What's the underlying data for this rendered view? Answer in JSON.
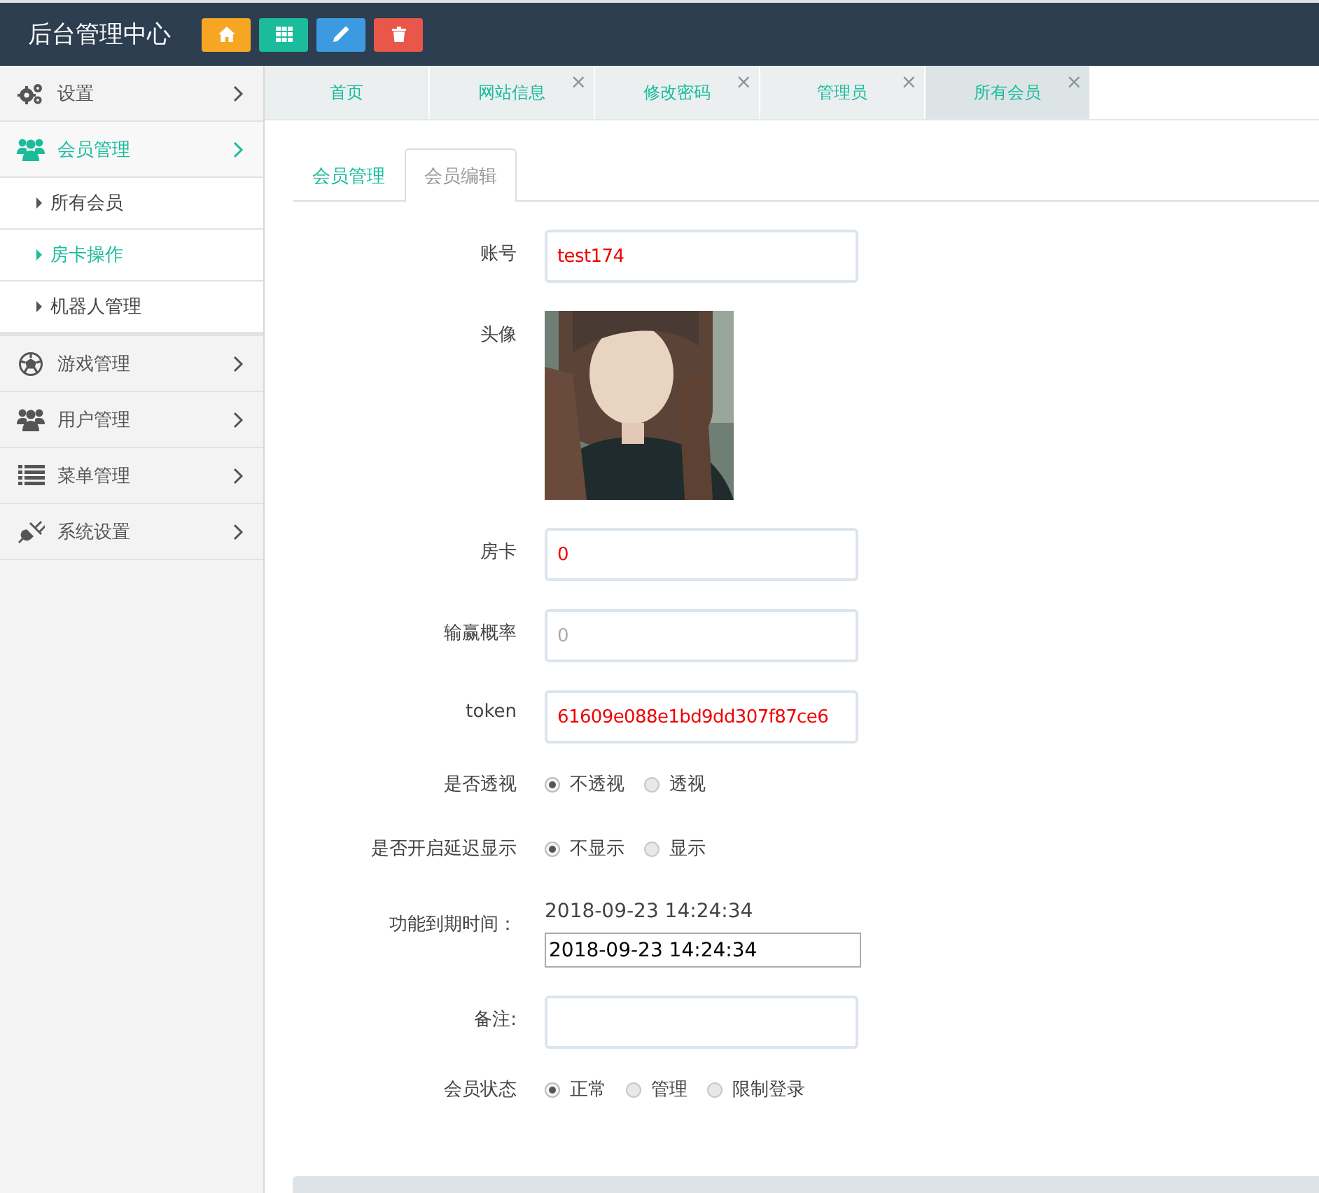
{
  "header": {
    "title": "后台管理中心",
    "buttons": [
      {
        "kind": "home",
        "color": "#f6a623"
      },
      {
        "kind": "grid",
        "color": "#1abc9c"
      },
      {
        "kind": "pencil",
        "color": "#3c9ae0"
      },
      {
        "kind": "trash",
        "color": "#e9574a"
      }
    ]
  },
  "sidebar": {
    "items": [
      {
        "label": "设置",
        "kind": "gears",
        "expanded": false
      },
      {
        "label": "会员管理",
        "kind": "users",
        "expanded": true,
        "children": [
          {
            "label": "所有会员",
            "selected": false
          },
          {
            "label": "房卡操作",
            "selected": true
          },
          {
            "label": "机器人管理",
            "selected": false
          }
        ]
      },
      {
        "label": "游戏管理",
        "kind": "ball",
        "expanded": false
      },
      {
        "label": "用户管理",
        "kind": "users",
        "expanded": false
      },
      {
        "label": "菜单管理",
        "kind": "list",
        "expanded": false
      },
      {
        "label": "系统设置",
        "kind": "plug",
        "expanded": false
      }
    ]
  },
  "page_tabs": [
    {
      "label": "首页",
      "closable": false,
      "selected": false
    },
    {
      "label": "网站信息",
      "closable": true,
      "selected": false
    },
    {
      "label": "修改密码",
      "closable": true,
      "selected": false
    },
    {
      "label": "管理员",
      "closable": true,
      "selected": false
    },
    {
      "label": "所有会员",
      "closable": true,
      "selected": true
    }
  ],
  "close_mark": "×",
  "content_tabs": [
    {
      "label": "会员管理",
      "selected": false
    },
    {
      "label": "会员编辑",
      "selected": true
    }
  ],
  "form": [
    {
      "label": "账号",
      "kind": "input",
      "value": "test174"
    },
    {
      "label": "头像",
      "kind": "picture"
    },
    {
      "label": "房卡",
      "kind": "input",
      "value": "0"
    },
    {
      "label": "输赢概率",
      "kind": "input",
      "placeholder": "0"
    },
    {
      "label": "token",
      "kind": "input",
      "value": "61609e088e1bd9dd307f87ce6"
    },
    {
      "label": "是否透视",
      "kind": "radio",
      "options": [
        {
          "label": "不透视",
          "selected": true
        },
        {
          "label": "透视",
          "selected": false
        }
      ]
    },
    {
      "label": "是否开启延迟显示",
      "kind": "radio",
      "options": [
        {
          "label": "不显示",
          "selected": true
        },
        {
          "label": "显示",
          "selected": false
        }
      ]
    },
    {
      "label": "功能到期时间：",
      "kind": "datetime",
      "text": "2018-09-23 14:24:34",
      "value": "2018-09-23 14:24:34"
    },
    {
      "label": "备注:",
      "kind": "input"
    },
    {
      "label": "会员状态",
      "kind": "radio",
      "options": [
        {
          "label": "正常",
          "selected": true
        },
        {
          "label": "管理",
          "selected": false
        },
        {
          "label": "限制登录",
          "selected": false
        }
      ]
    }
  ]
}
